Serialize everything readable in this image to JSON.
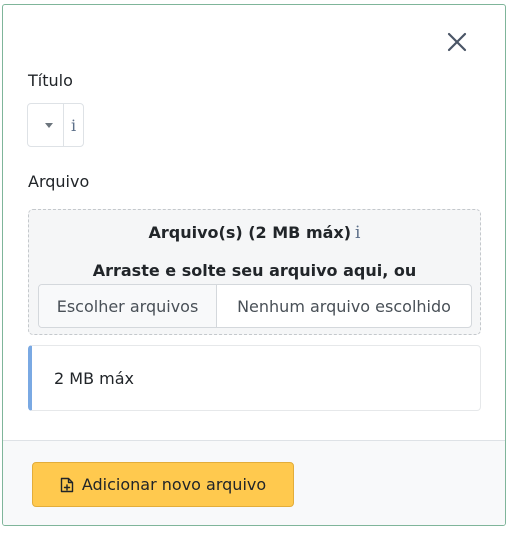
{
  "modal": {
    "close_icon": "close-icon"
  },
  "form": {
    "titulo_label": "Título",
    "titulo_select": {
      "info_glyph": "i"
    },
    "arquivo_label": "Arquivo",
    "dropzone": {
      "title": "Arquivo(s) (2 MB máx)",
      "info_glyph": "i",
      "subtitle": "Arraste e solte seu arquivo aqui, ou",
      "choose_button": "Escolher arquivos",
      "no_file_text": "Nenhum arquivo escolhido"
    },
    "help_text": "2 MB máx"
  },
  "footer": {
    "add_button_label": "Adicionar novo arquivo",
    "add_button_icon": "file-plus-icon"
  },
  "colors": {
    "accent_border": "#7fb59a",
    "info_bar": "#7aa9e3",
    "add_button_bg": "#ffc94e"
  }
}
